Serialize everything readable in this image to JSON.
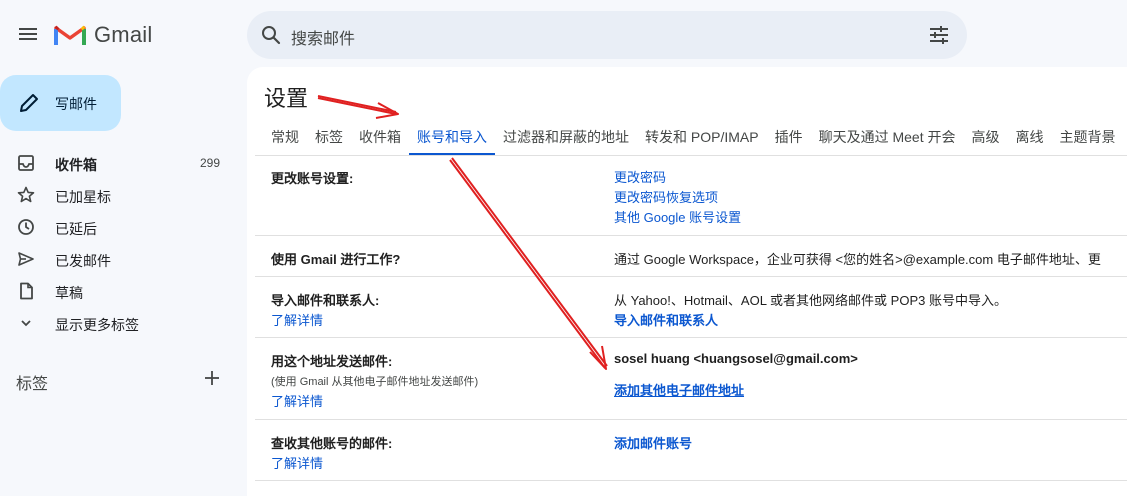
{
  "app": {
    "name": "Gmail"
  },
  "search": {
    "placeholder": "搜索邮件"
  },
  "sidebar": {
    "compose_label": "写邮件",
    "items": [
      {
        "label": "收件箱",
        "count": "299",
        "icon": "inbox-icon"
      },
      {
        "label": "已加星标",
        "icon": "star-icon"
      },
      {
        "label": "已延后",
        "icon": "clock-icon"
      },
      {
        "label": "已发邮件",
        "icon": "send-icon"
      },
      {
        "label": "草稿",
        "icon": "draft-icon"
      },
      {
        "label": "显示更多标签",
        "icon": "chevron-down-icon"
      }
    ],
    "labels_heading": "标签"
  },
  "settings": {
    "title": "设置",
    "tabs": [
      {
        "label": "常规"
      },
      {
        "label": "标签"
      },
      {
        "label": "收件箱"
      },
      {
        "label": "账号和导入",
        "active": true
      },
      {
        "label": "过滤器和屏蔽的地址"
      },
      {
        "label": "转发和 POP/IMAP"
      },
      {
        "label": "插件"
      },
      {
        "label": "聊天及通过 Meet 开会"
      },
      {
        "label": "高级"
      },
      {
        "label": "离线"
      },
      {
        "label": "主题背景"
      }
    ],
    "rows": {
      "change_account": {
        "label": "更改账号设置:",
        "links": [
          "更改密码",
          "更改密码恢复选项",
          "其他 Google 账号设置"
        ]
      },
      "workspace": {
        "label": "使用 Gmail 进行工作?",
        "value": "通过 Google Workspace，企业可获得 <您的姓名>@example.com 电子邮件地址、更"
      },
      "import": {
        "label": "导入邮件和联系人:",
        "learn_more": "了解详情",
        "value": "从 Yahoo!、Hotmail、AOL 或者其他网络邮件或 POP3 账号中导入。",
        "link": "导入邮件和联系人"
      },
      "send_as": {
        "label": "用这个地址发送邮件:",
        "sub": "(使用 Gmail 从其他电子邮件地址发送邮件)",
        "learn_more": "了解详情",
        "value": "sosel huang <huangsosel@gmail.com>",
        "link": "添加其他电子邮件地址"
      },
      "check_mail": {
        "label": "查收其他账号的邮件:",
        "learn_more": "了解详情",
        "link": "添加邮件账号"
      }
    }
  },
  "colors": {
    "accent": "#0b57d0",
    "compose_bg": "#c2e7ff",
    "annotation": "#e02020"
  }
}
